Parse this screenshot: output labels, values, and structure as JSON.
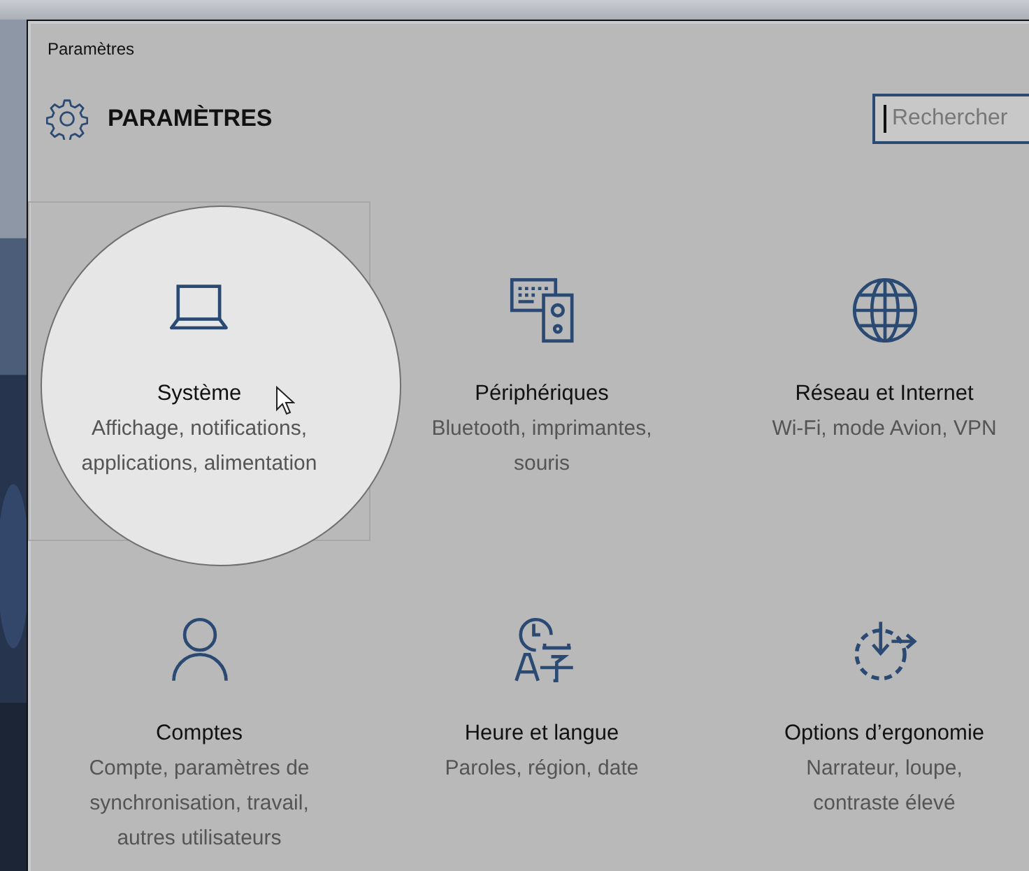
{
  "window": {
    "title": "Paramètres"
  },
  "header": {
    "title": "PARAMÈTRES"
  },
  "search": {
    "placeholder": "Rechercher"
  },
  "tiles": [
    {
      "title": "Système",
      "description": "Affichage, notifications, applications, alimentation",
      "selected": true
    },
    {
      "title": "Périphériques",
      "description": "Bluetooth, imprimantes, souris",
      "selected": false
    },
    {
      "title": "Réseau et Internet",
      "description": "Wi-Fi, mode Avion, VPN",
      "selected": false
    },
    {
      "title": "Comptes",
      "description": "Compte, paramètres de synchronisation, travail, autres utilisateurs",
      "selected": false
    },
    {
      "title": "Heure et langue",
      "description": "Paroles, région, date",
      "selected": false
    },
    {
      "title": "Options d’ergonomie",
      "description": "Narrateur, loupe, contraste élevé",
      "selected": false
    }
  ]
}
